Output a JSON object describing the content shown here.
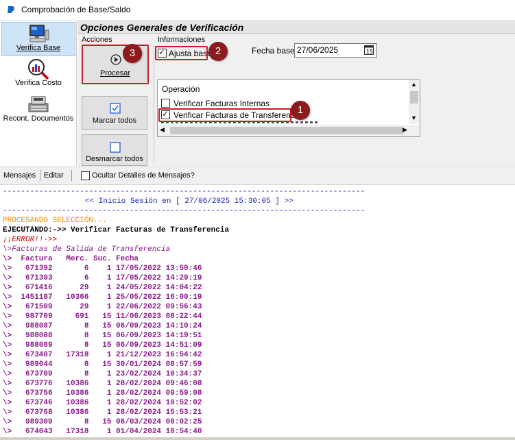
{
  "window": {
    "title": "Comprobación de Base/Saldo"
  },
  "sidebar": {
    "items": [
      {
        "label": "Verifica Base",
        "icon": "computer-icon"
      },
      {
        "label": "Verifica Costo",
        "icon": "magnifier-chart-icon"
      },
      {
        "label": "Recont. Documentos",
        "icon": "cash-register-icon"
      }
    ]
  },
  "panel": {
    "title": "Opciones Generales de Verificación",
    "acciones_label": "Acciones",
    "informaciones_label": "Informaciones",
    "procesar_label": "Procesar",
    "marcar_label": "Marcar todos",
    "desmarcar_label": "Desmarcar todos",
    "ajusta_base_label": "Ajusta base",
    "ajusta_base_checked": true,
    "fecha_base_label": "Fecha base",
    "fecha_base_value": "27/06/2025",
    "operacion_header": "Operación",
    "operaciones": [
      {
        "label": "Verificar Facturas Internas",
        "checked": false
      },
      {
        "label": "Verificar Facturas de Transferencia",
        "checked": true
      }
    ]
  },
  "annotations": [
    "1",
    "2",
    "3"
  ],
  "messages_bar": {
    "menu_mensajes": "Mensajes",
    "menu_editar": "Editar",
    "ocultar_label": "Ocultar Detalles de Mensajes?"
  },
  "log": {
    "separator": "--------------------------------------------------------------------------------",
    "session_start": "<< Inicio Sesión en [ 27/06/2025 15:30:05 ] >>",
    "procesando": "PROCESANDO SELECCIÓN...",
    "ejecutando": "EJECUTANDO:->> Verificar Facturas de Transferencia",
    "error": "¡¡ERROR!!->>",
    "section_title": "\\>Facturas de Salida de Transferencia",
    "table_header": "\\>  Factura   Merc. Suc. Fecha",
    "rows": [
      "\\>   671392       6    1 17/05/2022 13:50:46",
      "\\>   671393       6    1 17/05/2022 14:29:19",
      "\\>   671416      29    1 24/05/2022 14:04:22",
      "\\>  1451187   10366    1 25/05/2022 16:00:19",
      "\\>   671509      29    1 22/06/2022 09:56:43",
      "\\>   987709     691   15 11/06/2023 08:22:44",
      "\\>   988087       8   15 06/09/2023 14:10:24",
      "\\>   988088       8   15 06/09/2023 14:19:51",
      "\\>   988089       8   15 06/09/2023 14:51:09",
      "\\>   673487   17318    1 21/12/2023 16:54:42",
      "\\>   989044       8   15 30/01/2024 08:57:59",
      "\\>   673709       8    1 23/02/2024 10:34:37",
      "\\>   673776   10386    1 28/02/2024 09:46:08",
      "\\>   673756   10386    1 28/02/2024 09:59:08",
      "\\>   673746   10386    1 28/02/2024 10:52:02",
      "\\>   673768   10386    1 28/02/2024 15:53:21",
      "\\>   989309       8   15 06/03/2024 08:02:25",
      "\\>   674043   17318    1 01/04/2024 10:54:40"
    ]
  }
}
